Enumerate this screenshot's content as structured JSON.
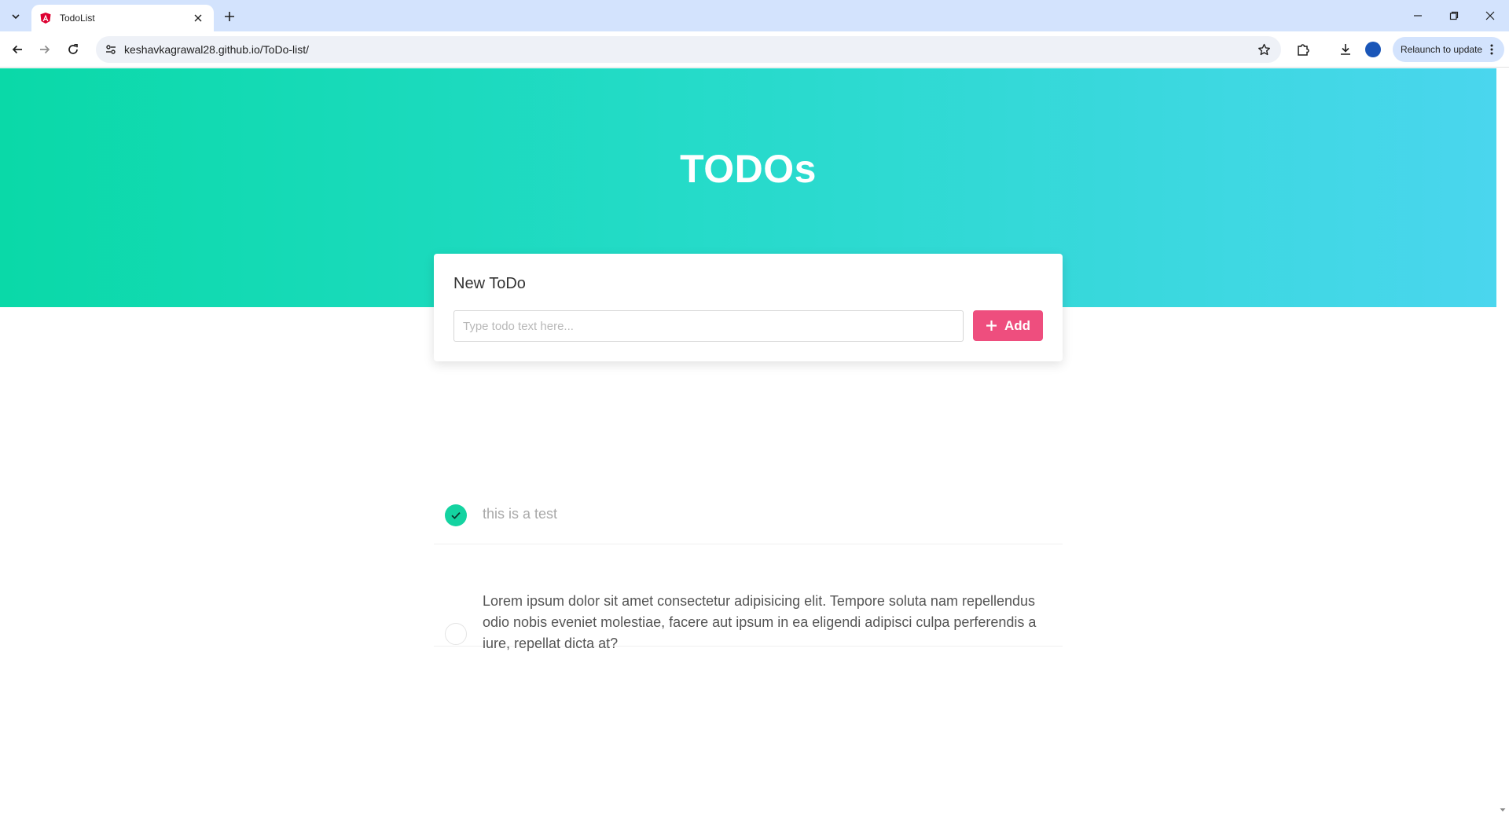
{
  "browser": {
    "tab_title": "TodoList",
    "url": "keshavkagrawal28.github.io/ToDo-list/",
    "relaunch_label": "Relaunch to update"
  },
  "page": {
    "heading": "TODOs",
    "new_todo": {
      "title": "New ToDo",
      "input_value": "",
      "input_placeholder": "Type todo text here...",
      "add_label": "Add"
    },
    "todos": [
      {
        "text": "this is a test",
        "completed": true
      },
      {
        "text": "Lorem ipsum dolor sit amet consectetur adipisicing elit. Tempore soluta nam repellendus odio nobis eveniet molestiae, facere aut ipsum in ea eligendi adipisci culpa perferendis a iure, repellat dicta at?",
        "completed": false
      }
    ]
  },
  "colors": {
    "gradient_start": "#0ad9a8",
    "gradient_end": "#4ad6ee",
    "add_button": "#ee4e7e",
    "check_done": "#14d3a1"
  }
}
